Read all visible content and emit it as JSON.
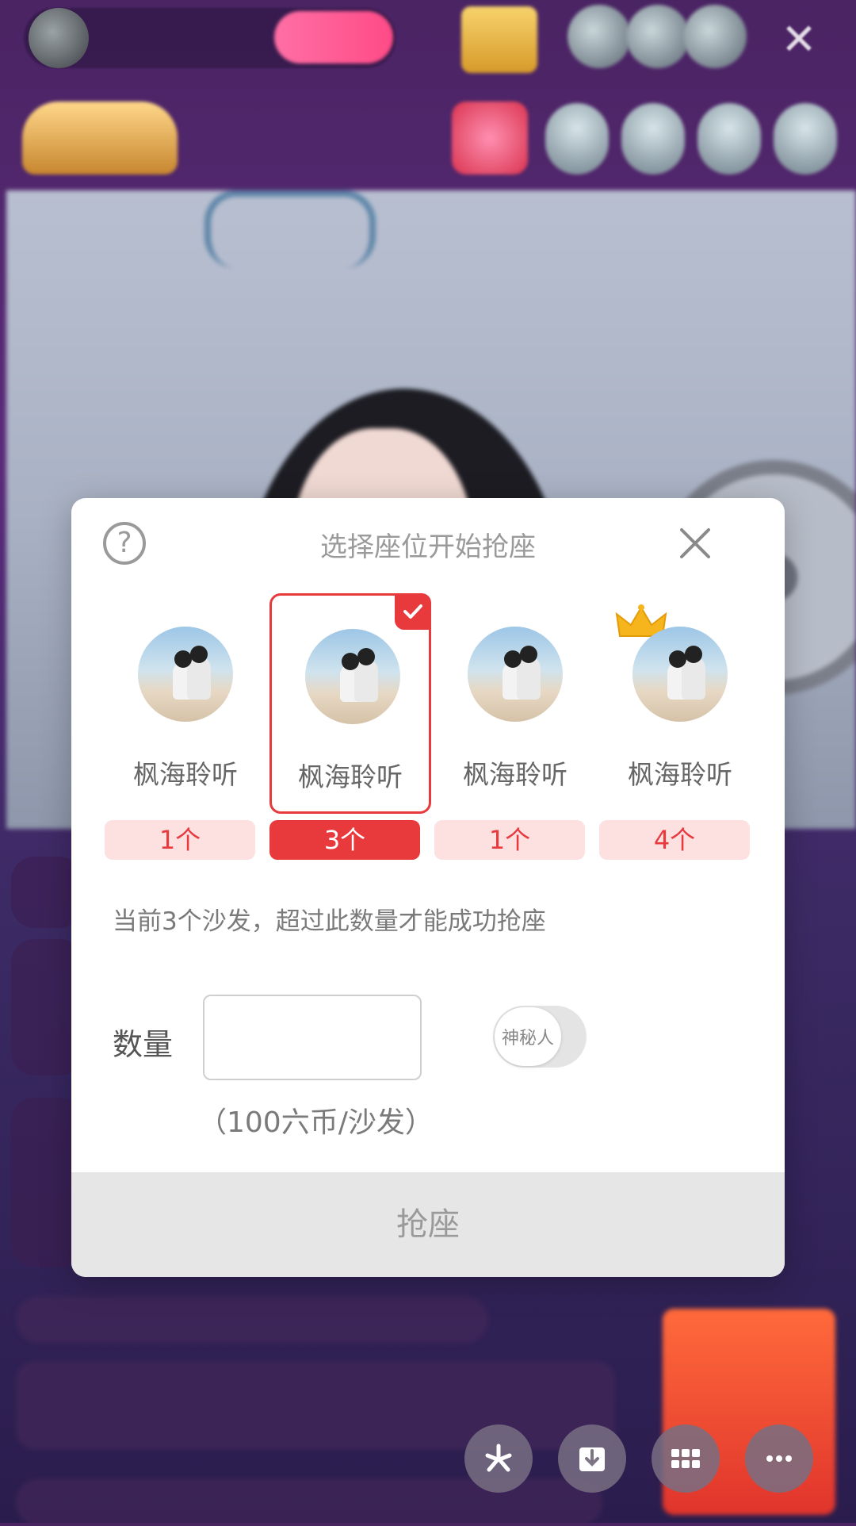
{
  "modal": {
    "title": "选择座位开始抢座",
    "help_symbol": "?",
    "seats": [
      {
        "name": "枫海聆听",
        "count": "1个",
        "selected": false,
        "crown": false
      },
      {
        "name": "枫海聆听",
        "count": "3个",
        "selected": true,
        "crown": false
      },
      {
        "name": "枫海聆听",
        "count": "1个",
        "selected": false,
        "crown": false
      },
      {
        "name": "枫海聆听",
        "count": "4个",
        "selected": false,
        "crown": true
      }
    ],
    "hint": "当前3个沙发，超过此数量才能成功抢座",
    "quantity_label": "数量",
    "quantity_value": "",
    "toggle_label": "神秘人",
    "price_note": "（100六币/沙发）",
    "submit_label": "抢座"
  },
  "colors": {
    "accent": "#e8393d",
    "pill_bg": "#fde0e0",
    "disabled_btn": "#e6e6e6"
  },
  "icons": {
    "help": "question-circle-icon",
    "close": "close-icon",
    "check": "checkmark-icon",
    "crown": "crown-icon",
    "bottom": [
      "share-icon",
      "download-icon",
      "grid-icon",
      "more-icon"
    ]
  }
}
